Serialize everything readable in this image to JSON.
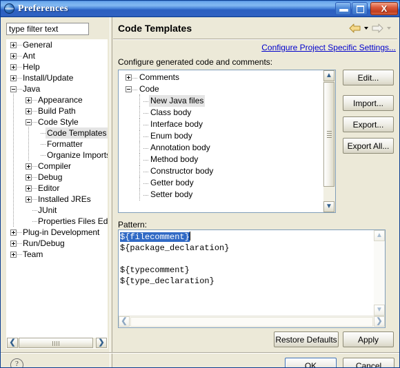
{
  "window": {
    "title": "Preferences",
    "icon": "eclipse-globe-icon",
    "minimize_label": "",
    "maximize_label": "",
    "close_label": "X"
  },
  "sidebar": {
    "filter": {
      "value": "type filter text",
      "placeholder": "type filter text"
    },
    "tree": [
      {
        "label": "General",
        "level": 0,
        "state": "collapsed"
      },
      {
        "label": "Ant",
        "level": 0,
        "state": "collapsed"
      },
      {
        "label": "Help",
        "level": 0,
        "state": "collapsed"
      },
      {
        "label": "Install/Update",
        "level": 0,
        "state": "collapsed"
      },
      {
        "label": "Java",
        "level": 0,
        "state": "expanded"
      },
      {
        "label": "Appearance",
        "level": 1,
        "state": "collapsed"
      },
      {
        "label": "Build Path",
        "level": 1,
        "state": "collapsed"
      },
      {
        "label": "Code Style",
        "level": 1,
        "state": "expanded"
      },
      {
        "label": "Code Templates",
        "level": 2,
        "state": "leaf",
        "selected": true
      },
      {
        "label": "Formatter",
        "level": 2,
        "state": "leaf"
      },
      {
        "label": "Organize Imports",
        "level": 2,
        "state": "leaf"
      },
      {
        "label": "Compiler",
        "level": 1,
        "state": "collapsed"
      },
      {
        "label": "Debug",
        "level": 1,
        "state": "collapsed"
      },
      {
        "label": "Editor",
        "level": 1,
        "state": "collapsed"
      },
      {
        "label": "Installed JREs",
        "level": 1,
        "state": "collapsed"
      },
      {
        "label": "JUnit",
        "level": 1,
        "state": "leaf"
      },
      {
        "label": "Properties Files Edito",
        "level": 1,
        "state": "leaf"
      },
      {
        "label": "Plug-in Development",
        "level": 0,
        "state": "collapsed"
      },
      {
        "label": "Run/Debug",
        "level": 0,
        "state": "collapsed"
      },
      {
        "label": "Team",
        "level": 0,
        "state": "collapsed"
      }
    ]
  },
  "page": {
    "title": "Code Templates",
    "back_icon": "back-arrow-icon",
    "forward_icon": "forward-arrow-icon",
    "link_configure": "Configure Project Specific Settings...",
    "label_generated": "Configure generated code and comments:",
    "templates": [
      {
        "label": "Comments",
        "level": 0,
        "state": "collapsed"
      },
      {
        "label": "Code",
        "level": 0,
        "state": "expanded"
      },
      {
        "label": "New Java files",
        "level": 1,
        "state": "leaf",
        "selected": true
      },
      {
        "label": "Class body",
        "level": 1,
        "state": "leaf"
      },
      {
        "label": "Interface body",
        "level": 1,
        "state": "leaf"
      },
      {
        "label": "Enum body",
        "level": 1,
        "state": "leaf"
      },
      {
        "label": "Annotation body",
        "level": 1,
        "state": "leaf"
      },
      {
        "label": "Method body",
        "level": 1,
        "state": "leaf"
      },
      {
        "label": "Constructor body",
        "level": 1,
        "state": "leaf"
      },
      {
        "label": "Getter body",
        "level": 1,
        "state": "leaf"
      },
      {
        "label": "Setter body",
        "level": 1,
        "state": "leaf"
      }
    ],
    "buttons": {
      "edit": "Edit...",
      "import": "Import...",
      "export": "Export...",
      "export_all": "Export All..."
    },
    "pattern": {
      "label": "Pattern:",
      "selected_line": "${filecomment}",
      "lines": [
        "${package_declaration}",
        "",
        "${typecomment}",
        "${type_declaration}"
      ]
    },
    "restore_defaults": "Restore Defaults",
    "apply": "Apply"
  },
  "footer": {
    "help_icon": "?",
    "ok": "OK",
    "cancel": "Cancel"
  },
  "colors": {
    "title_bar_start": "#6ea9ec",
    "title_bar_end": "#2a5bb8",
    "dialog_bg": "#ece9d8",
    "link": "#0000cc",
    "selection_blue": "#316ac5",
    "selection_gray": "#e4e4e4",
    "field_border": "#7f9db9",
    "close_button": "#c03d20"
  }
}
